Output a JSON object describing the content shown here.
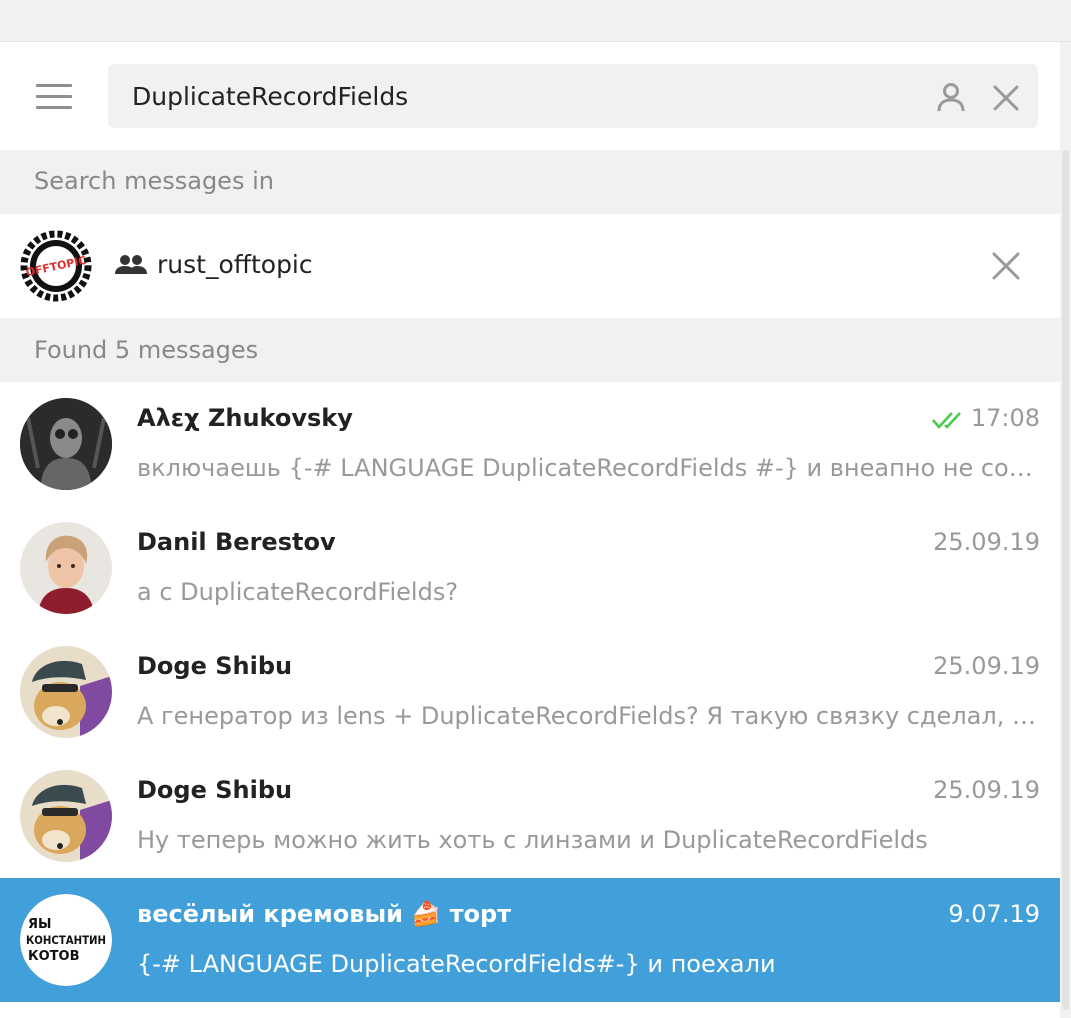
{
  "search": {
    "query": "DuplicateRecordFields"
  },
  "sections": {
    "search_in": "Search messages in",
    "found": "Found 5 messages"
  },
  "chat_filter": {
    "name": "rust_offtopic",
    "logo_text": "OFFTOPIC"
  },
  "results": [
    {
      "name": "Αλεχ Zhukovsky",
      "date": "17:08",
      "text": "включаешь {-# LANGUAGE DuplicateRecordFields #-} и внеапно не сосут",
      "read": true
    },
    {
      "name": "Danil Berestov",
      "date": "25.09.19",
      "text": "а с DuplicateRecordFields?"
    },
    {
      "name": "Doge Shibu",
      "date": "25.09.19",
      "text": "А генератор из lens + DuplicateRecordFields?  Я такую связку сделал, в..."
    },
    {
      "name": "Doge Shibu",
      "date": "25.09.19",
      "text": "Ну теперь можно жить хоть с линзами и DuplicateRecordFields"
    },
    {
      "name": "весёлый кремовый 🍰 торт",
      "date": "9.07.19",
      "text": "{-# LANGUAGE DuplicateRecordFields#-}  и поехали",
      "avatar_text": [
        "ЯЫ",
        "КОНСТАНТИН",
        "КОТОВ"
      ],
      "selected": true
    }
  ],
  "colors": {
    "accent": "#419fd9",
    "read_check": "#4dc94d",
    "section_bg": "#f1f1f1"
  }
}
